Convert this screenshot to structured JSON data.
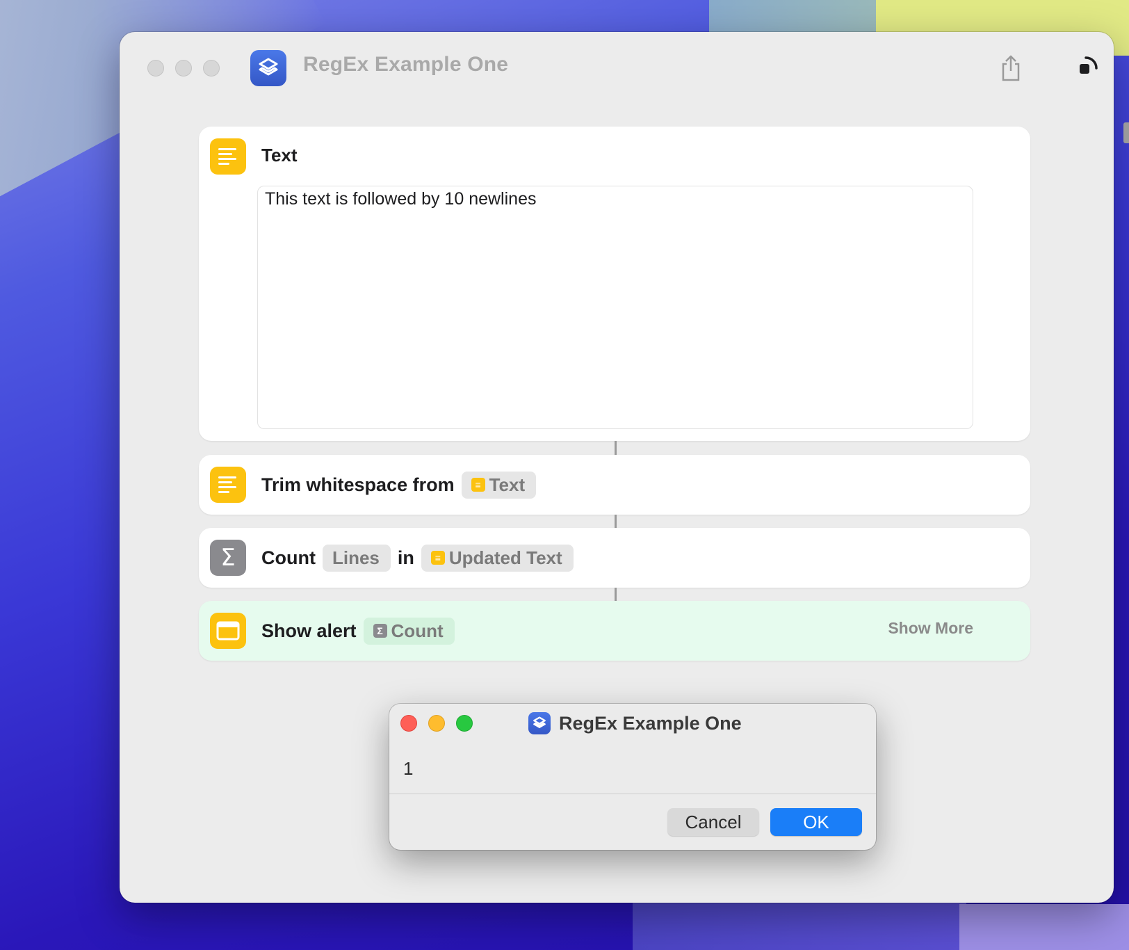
{
  "window": {
    "title": "RegEx Example One"
  },
  "actions": {
    "text_action": {
      "title": "Text",
      "content": "This text is followed by 10 newlines",
      "icon": "text-lines-icon"
    },
    "trim_action": {
      "label": "Trim whitespace from",
      "token": "Text",
      "icon": "text-lines-icon"
    },
    "count_action": {
      "label": "Count",
      "unit_token": "Lines",
      "connector_word": "in",
      "input_token": "Updated Text",
      "icon": "sigma-icon"
    },
    "alert_action": {
      "label": "Show alert",
      "token": "Count",
      "show_more": "Show More",
      "icon": "window-icon"
    }
  },
  "dialog": {
    "title": "RegEx Example One",
    "message": "1",
    "cancel_label": "Cancel",
    "ok_label": "OK"
  },
  "colors": {
    "accent_blue": "#1a7ef8",
    "action_yellow": "#fcc20f",
    "action_gray": "#8a8a8e",
    "alert_card_bg": "#e6fbee"
  }
}
